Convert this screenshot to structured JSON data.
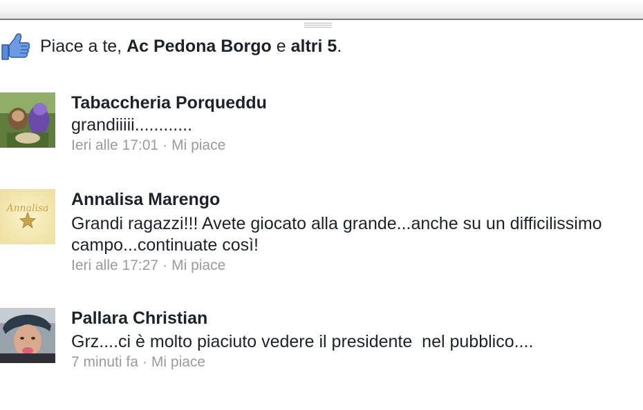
{
  "likes": {
    "prefix": "Piace a te, ",
    "name": "Ac Pedona Borgo",
    "conj": " e ",
    "others": "altri 5",
    "suffix": "."
  },
  "comments": [
    {
      "author": "Tabaccheria Porqueddu",
      "text": "grandiiiii............",
      "time": "Ieri alle 17:01",
      "separator": "·",
      "like": "Mi piace"
    },
    {
      "author": "Annalisa Marengo",
      "text": "Grandi ragazzi!!! Avete giocato alla grande...anche su un difficilissimo campo...continuate così!",
      "time": "Ieri alle 17:27",
      "separator": "·",
      "like": "Mi piace",
      "avatar_text": "Annalisa"
    },
    {
      "author": "Pallara Christian",
      "text": "Grz....ci è molto piaciuto vedere il presidente  nel pubblico....",
      "time": "7 minuti fa",
      "separator": "·",
      "like": "Mi piace"
    }
  ],
  "colors": {
    "like_blue": "#3b6fc4",
    "meta_gray": "#9a9a9a",
    "text": "#1d2129"
  }
}
